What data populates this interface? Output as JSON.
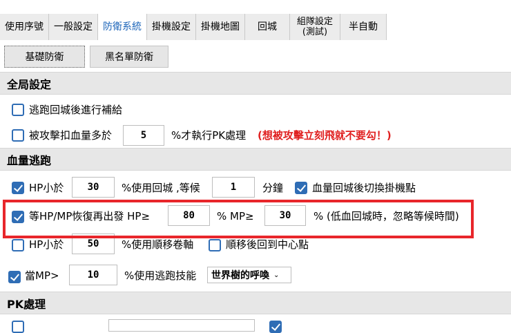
{
  "tabs": [
    {
      "label": "使用序號"
    },
    {
      "label": "一般設定"
    },
    {
      "label": "防衛系統"
    },
    {
      "label": "掛機設定"
    },
    {
      "label": "掛機地圖"
    },
    {
      "label": "回城"
    },
    {
      "label_line1": "組隊設定",
      "label_line2": "(測試)"
    },
    {
      "label": "半自動"
    }
  ],
  "subtabs": [
    {
      "label": "基礎防衛"
    },
    {
      "label": "黑名單防衛"
    }
  ],
  "global": {
    "title": "全局設定",
    "escape_resupply_label": "逃跑回城後進行補給",
    "pk_prefix": "被攻擊扣血量多於",
    "pk_value": "5",
    "pk_suffix": "%才執行PK處理",
    "pk_note": "(想被攻擊立刻飛就不要勾！)"
  },
  "hp_escape": {
    "title": "血量逃跑",
    "row1": {
      "hp_label": "HP小於",
      "hp_value": "30",
      "mid_label": "%使用回城 ,等候",
      "wait_value": "1",
      "unit": "分鐘",
      "switch_label": "血量回城後切換掛機點"
    },
    "row2": {
      "label": "等HP/MP恢復再出發 HP≥",
      "hp_value": "80",
      "mid_label": "% MP≥",
      "mp_value": "30",
      "suffix": "% (低血回城時，忽略等候時間)"
    },
    "row3": {
      "hp_label": "HP小於",
      "hp_value": "50",
      "mid_label": "%使用順移卷軸",
      "return_label": "順移後回到中心點"
    },
    "row4": {
      "mp_label": "當MP>",
      "mp_value": "10",
      "mid_label": "%使用逃跑技能",
      "skill_value": "世界樹的呼喚"
    }
  },
  "pk": {
    "title": "PK處理"
  }
}
